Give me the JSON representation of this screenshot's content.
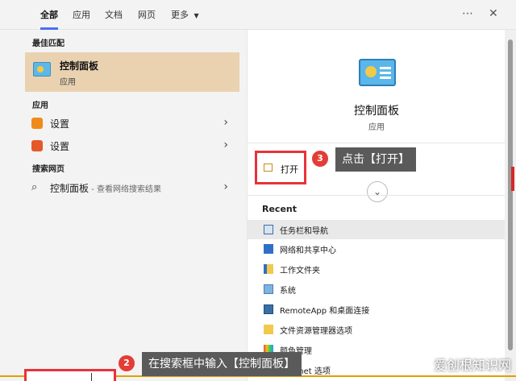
{
  "tabs": [
    {
      "label": "全部",
      "active": true
    },
    {
      "label": "应用"
    },
    {
      "label": "文档"
    },
    {
      "label": "网页"
    },
    {
      "label": "更多"
    }
  ],
  "topbar_icons": {
    "more": "more-dots-icon",
    "close": "close-icon"
  },
  "left": {
    "best_match_heading": "最佳匹配",
    "best_match": {
      "title": "控制面板",
      "subtitle": "应用",
      "icon": "control-panel-icon"
    },
    "apps_heading": "应用",
    "apps": [
      {
        "label": "设置",
        "icon": "settings-gear-icon"
      },
      {
        "label": "设置",
        "icon": "settings-s-icon"
      }
    ],
    "web_heading": "搜索网页",
    "web_result": {
      "label": "控制面板",
      "sub": " - 查看网络搜索结果",
      "icon": "search-icon"
    }
  },
  "right": {
    "title": "控制面板",
    "subtitle": "应用",
    "open_label": "打开",
    "recent_heading": "Recent",
    "recent_items": [
      {
        "label": "任务栏和导航",
        "icon": "taskbar-icon"
      },
      {
        "label": "网络和共享中心",
        "icon": "network-icon"
      },
      {
        "label": "工作文件夹",
        "icon": "work-folders-icon"
      },
      {
        "label": "系统",
        "icon": "system-icon"
      },
      {
        "label": "RemoteApp 和桌面连接",
        "icon": "remoteapp-icon"
      },
      {
        "label": "文件资源管理器选项",
        "icon": "folder-options-icon"
      },
      {
        "label": "颜色管理",
        "icon": "color-management-icon"
      },
      {
        "label": "Internet 选项",
        "icon": "internet-options-icon"
      }
    ]
  },
  "annotations": {
    "step2_number": "2",
    "step2_text": "在搜索框中输入【控制面板】",
    "step3_number": "3",
    "step3_text": "点击【打开】"
  },
  "watermark": "爱创根知识网",
  "colors": {
    "highlight": "#ead2b1",
    "annotation_red": "#e8323a",
    "callout_bg": "#5a5a5a"
  }
}
